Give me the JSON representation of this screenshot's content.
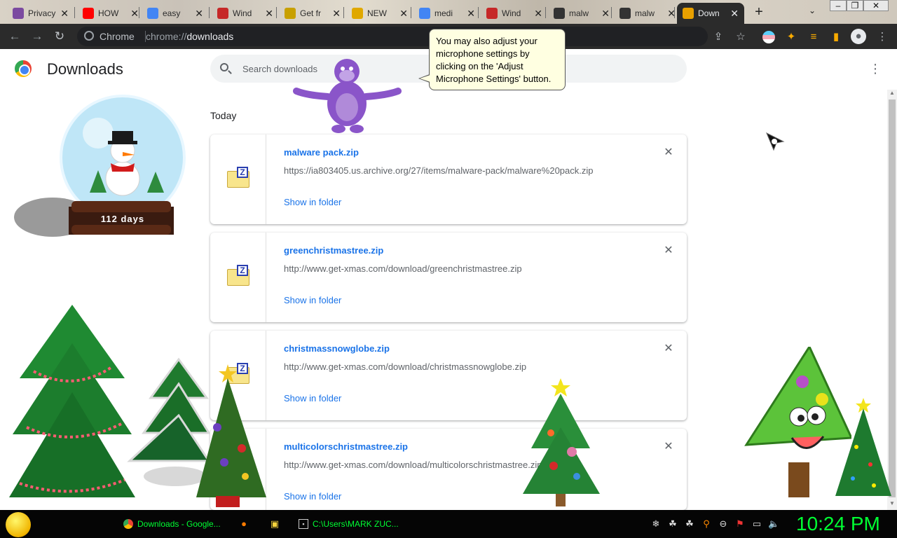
{
  "tabs": [
    {
      "label": "Privacy er",
      "favicon_color": "#7b4aa0"
    },
    {
      "label": "HOW",
      "favicon_color": "#ff0000"
    },
    {
      "label": "easy",
      "favicon_color": "#4285f4"
    },
    {
      "label": "Wind",
      "favicon_color": "#c62828"
    },
    {
      "label": "Get fr",
      "favicon_color": "#c8a000"
    },
    {
      "label": "NEW",
      "favicon_color": "#e0a800"
    },
    {
      "label": "medi",
      "favicon_color": "#4285f4"
    },
    {
      "label": "Wind",
      "favicon_color": "#c62828"
    },
    {
      "label": "malw",
      "favicon_color": "#333333"
    },
    {
      "label": "malw",
      "favicon_color": "#333333"
    },
    {
      "label": "Down",
      "favicon_color": "#e8a000"
    }
  ],
  "tab_close": "✕",
  "new_tab": "+",
  "toolbar": {
    "back": "←",
    "forward": "→",
    "reload": "↻",
    "site_label": "Chrome",
    "url_scheme": "chrome://",
    "url_path": "downloads"
  },
  "page": {
    "title": "Downloads",
    "search_placeholder": "Search downloads",
    "more_menu": "⋮",
    "section_date": "Today"
  },
  "downloads": [
    {
      "filename": "malware pack.zip",
      "url": "https://ia803405.us.archive.org/27/items/malware-pack/malware%20pack.zip",
      "action": "Show in folder"
    },
    {
      "filename": "greenchristmastree.zip",
      "url": "http://www.get-xmas.com/download/greenchristmastree.zip",
      "action": "Show in folder"
    },
    {
      "filename": "christmassnowglobe.zip",
      "url": "http://www.get-xmas.com/download/christmassnowglobe.zip",
      "action": "Show in folder"
    },
    {
      "filename": "multicolorschristmastree.zip",
      "url": "http://www.get-xmas.com/download/multicolorschristmastree.zip",
      "action": "Show in folder"
    }
  ],
  "remove_glyph": "✕",
  "zip_badge": "Z",
  "assistant_balloon": "You may also adjust your microphone settings by clicking on the 'Adjust Microphone Settings' button.",
  "snowglobe_counter": "112 days",
  "taskbar": {
    "chrome_task": "Downloads - Google...",
    "cmd_task": "C:\\Users\\MARK ZUC...",
    "clock": "10:24 PM"
  },
  "colors": {
    "accent_link": "#1a73e8",
    "clock_green": "#00ff33",
    "toolbar_dark": "#2b2b2b"
  }
}
